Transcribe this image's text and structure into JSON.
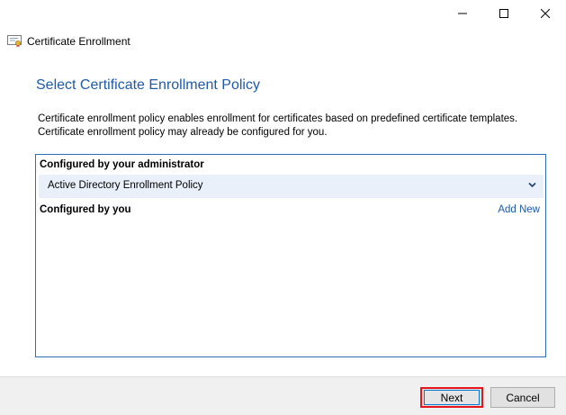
{
  "window": {
    "title": "Certificate Enrollment",
    "icon": "certificate-icon",
    "controls": {
      "minimize": "minimize-icon",
      "maximize": "maximize-icon",
      "close": "close-icon"
    }
  },
  "page": {
    "heading": "Select Certificate Enrollment Policy",
    "description_line1": "Certificate enrollment policy enables enrollment for certificates based on predefined certificate templates.",
    "description_line2": "Certificate enrollment policy may already be configured for you."
  },
  "policies": {
    "admin_section_label": "Configured by your administrator",
    "admin_items": [
      {
        "name": "Active Directory Enrollment Policy",
        "expand_icon": "chevron-down-icon"
      }
    ],
    "user_section_label": "Configured by you",
    "add_new_label": "Add New"
  },
  "footer": {
    "next_label": "Next",
    "cancel_label": "Cancel"
  },
  "colors": {
    "heading": "#1f5aa6",
    "link": "#1f5aa6",
    "list_border": "#2e6eb5",
    "selected_row": "#e9f0f9",
    "highlight_border": "#e8141c",
    "footer_bg": "#f0f0f0"
  }
}
